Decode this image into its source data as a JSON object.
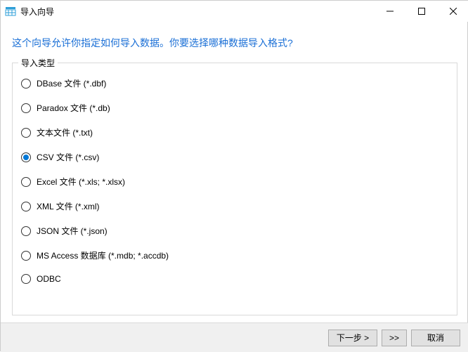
{
  "window": {
    "title": "导入向导"
  },
  "heading": "这个向导允许你指定如何导入数据。你要选择哪种数据导入格式?",
  "group": {
    "label": "导入类型",
    "options": [
      {
        "label": "DBase 文件 (*.dbf)",
        "selected": false
      },
      {
        "label": "Paradox 文件 (*.db)",
        "selected": false
      },
      {
        "label": "文本文件 (*.txt)",
        "selected": false
      },
      {
        "label": "CSV 文件 (*.csv)",
        "selected": true
      },
      {
        "label": "Excel 文件 (*.xls; *.xlsx)",
        "selected": false
      },
      {
        "label": "XML 文件 (*.xml)",
        "selected": false
      },
      {
        "label": "JSON 文件 (*.json)",
        "selected": false
      },
      {
        "label": "MS Access 数据库 (*.mdb; *.accdb)",
        "selected": false
      },
      {
        "label": "ODBC",
        "selected": false
      }
    ]
  },
  "footer": {
    "next": "下一步 >",
    "skip": ">>",
    "cancel": "取消"
  }
}
